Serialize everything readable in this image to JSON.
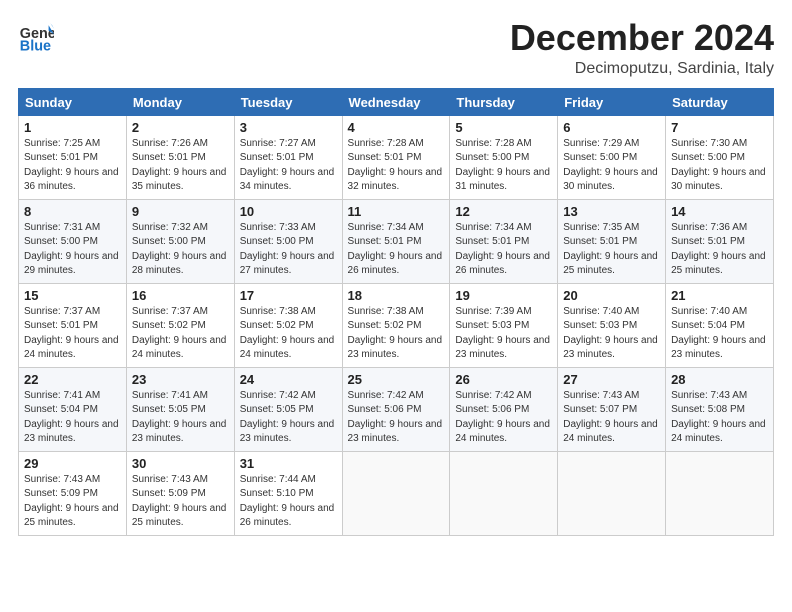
{
  "header": {
    "logo_general": "General",
    "logo_blue": "Blue",
    "month": "December 2024",
    "location": "Decimoputzu, Sardinia, Italy"
  },
  "weekdays": [
    "Sunday",
    "Monday",
    "Tuesday",
    "Wednesday",
    "Thursday",
    "Friday",
    "Saturday"
  ],
  "weeks": [
    [
      {
        "day": "1",
        "sunrise": "Sunrise: 7:25 AM",
        "sunset": "Sunset: 5:01 PM",
        "daylight": "Daylight: 9 hours and 36 minutes."
      },
      {
        "day": "2",
        "sunrise": "Sunrise: 7:26 AM",
        "sunset": "Sunset: 5:01 PM",
        "daylight": "Daylight: 9 hours and 35 minutes."
      },
      {
        "day": "3",
        "sunrise": "Sunrise: 7:27 AM",
        "sunset": "Sunset: 5:01 PM",
        "daylight": "Daylight: 9 hours and 34 minutes."
      },
      {
        "day": "4",
        "sunrise": "Sunrise: 7:28 AM",
        "sunset": "Sunset: 5:01 PM",
        "daylight": "Daylight: 9 hours and 32 minutes."
      },
      {
        "day": "5",
        "sunrise": "Sunrise: 7:28 AM",
        "sunset": "Sunset: 5:00 PM",
        "daylight": "Daylight: 9 hours and 31 minutes."
      },
      {
        "day": "6",
        "sunrise": "Sunrise: 7:29 AM",
        "sunset": "Sunset: 5:00 PM",
        "daylight": "Daylight: 9 hours and 30 minutes."
      },
      {
        "day": "7",
        "sunrise": "Sunrise: 7:30 AM",
        "sunset": "Sunset: 5:00 PM",
        "daylight": "Daylight: 9 hours and 30 minutes."
      }
    ],
    [
      {
        "day": "8",
        "sunrise": "Sunrise: 7:31 AM",
        "sunset": "Sunset: 5:00 PM",
        "daylight": "Daylight: 9 hours and 29 minutes."
      },
      {
        "day": "9",
        "sunrise": "Sunrise: 7:32 AM",
        "sunset": "Sunset: 5:00 PM",
        "daylight": "Daylight: 9 hours and 28 minutes."
      },
      {
        "day": "10",
        "sunrise": "Sunrise: 7:33 AM",
        "sunset": "Sunset: 5:00 PM",
        "daylight": "Daylight: 9 hours and 27 minutes."
      },
      {
        "day": "11",
        "sunrise": "Sunrise: 7:34 AM",
        "sunset": "Sunset: 5:01 PM",
        "daylight": "Daylight: 9 hours and 26 minutes."
      },
      {
        "day": "12",
        "sunrise": "Sunrise: 7:34 AM",
        "sunset": "Sunset: 5:01 PM",
        "daylight": "Daylight: 9 hours and 26 minutes."
      },
      {
        "day": "13",
        "sunrise": "Sunrise: 7:35 AM",
        "sunset": "Sunset: 5:01 PM",
        "daylight": "Daylight: 9 hours and 25 minutes."
      },
      {
        "day": "14",
        "sunrise": "Sunrise: 7:36 AM",
        "sunset": "Sunset: 5:01 PM",
        "daylight": "Daylight: 9 hours and 25 minutes."
      }
    ],
    [
      {
        "day": "15",
        "sunrise": "Sunrise: 7:37 AM",
        "sunset": "Sunset: 5:01 PM",
        "daylight": "Daylight: 9 hours and 24 minutes."
      },
      {
        "day": "16",
        "sunrise": "Sunrise: 7:37 AM",
        "sunset": "Sunset: 5:02 PM",
        "daylight": "Daylight: 9 hours and 24 minutes."
      },
      {
        "day": "17",
        "sunrise": "Sunrise: 7:38 AM",
        "sunset": "Sunset: 5:02 PM",
        "daylight": "Daylight: 9 hours and 24 minutes."
      },
      {
        "day": "18",
        "sunrise": "Sunrise: 7:38 AM",
        "sunset": "Sunset: 5:02 PM",
        "daylight": "Daylight: 9 hours and 23 minutes."
      },
      {
        "day": "19",
        "sunrise": "Sunrise: 7:39 AM",
        "sunset": "Sunset: 5:03 PM",
        "daylight": "Daylight: 9 hours and 23 minutes."
      },
      {
        "day": "20",
        "sunrise": "Sunrise: 7:40 AM",
        "sunset": "Sunset: 5:03 PM",
        "daylight": "Daylight: 9 hours and 23 minutes."
      },
      {
        "day": "21",
        "sunrise": "Sunrise: 7:40 AM",
        "sunset": "Sunset: 5:04 PM",
        "daylight": "Daylight: 9 hours and 23 minutes."
      }
    ],
    [
      {
        "day": "22",
        "sunrise": "Sunrise: 7:41 AM",
        "sunset": "Sunset: 5:04 PM",
        "daylight": "Daylight: 9 hours and 23 minutes."
      },
      {
        "day": "23",
        "sunrise": "Sunrise: 7:41 AM",
        "sunset": "Sunset: 5:05 PM",
        "daylight": "Daylight: 9 hours and 23 minutes."
      },
      {
        "day": "24",
        "sunrise": "Sunrise: 7:42 AM",
        "sunset": "Sunset: 5:05 PM",
        "daylight": "Daylight: 9 hours and 23 minutes."
      },
      {
        "day": "25",
        "sunrise": "Sunrise: 7:42 AM",
        "sunset": "Sunset: 5:06 PM",
        "daylight": "Daylight: 9 hours and 23 minutes."
      },
      {
        "day": "26",
        "sunrise": "Sunrise: 7:42 AM",
        "sunset": "Sunset: 5:06 PM",
        "daylight": "Daylight: 9 hours and 24 minutes."
      },
      {
        "day": "27",
        "sunrise": "Sunrise: 7:43 AM",
        "sunset": "Sunset: 5:07 PM",
        "daylight": "Daylight: 9 hours and 24 minutes."
      },
      {
        "day": "28",
        "sunrise": "Sunrise: 7:43 AM",
        "sunset": "Sunset: 5:08 PM",
        "daylight": "Daylight: 9 hours and 24 minutes."
      }
    ],
    [
      {
        "day": "29",
        "sunrise": "Sunrise: 7:43 AM",
        "sunset": "Sunset: 5:09 PM",
        "daylight": "Daylight: 9 hours and 25 minutes."
      },
      {
        "day": "30",
        "sunrise": "Sunrise: 7:43 AM",
        "sunset": "Sunset: 5:09 PM",
        "daylight": "Daylight: 9 hours and 25 minutes."
      },
      {
        "day": "31",
        "sunrise": "Sunrise: 7:44 AM",
        "sunset": "Sunset: 5:10 PM",
        "daylight": "Daylight: 9 hours and 26 minutes."
      },
      null,
      null,
      null,
      null
    ]
  ]
}
